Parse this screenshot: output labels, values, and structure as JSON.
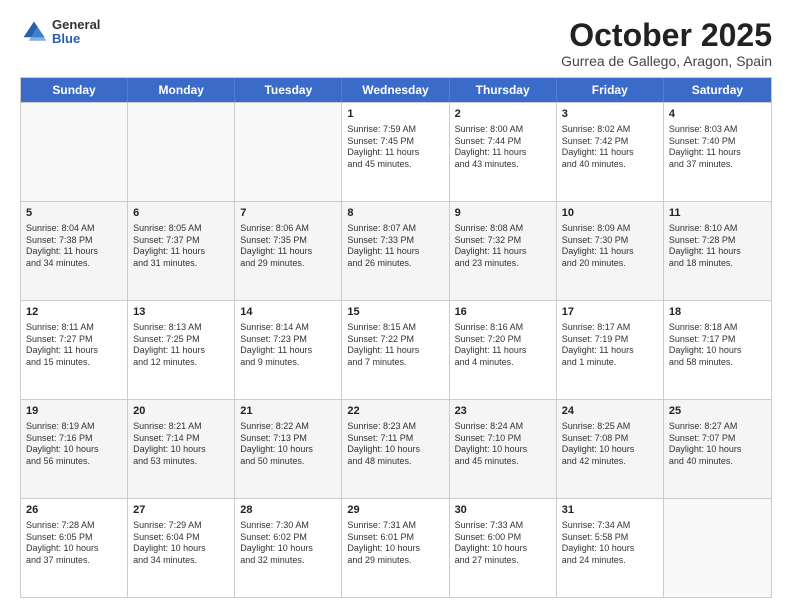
{
  "header": {
    "logo_general": "General",
    "logo_blue": "Blue",
    "month_title": "October 2025",
    "location": "Gurrea de Gallego, Aragon, Spain"
  },
  "weekdays": [
    "Sunday",
    "Monday",
    "Tuesday",
    "Wednesday",
    "Thursday",
    "Friday",
    "Saturday"
  ],
  "rows": [
    [
      {
        "day": "",
        "info": "",
        "empty": true
      },
      {
        "day": "",
        "info": "",
        "empty": true
      },
      {
        "day": "",
        "info": "",
        "empty": true
      },
      {
        "day": "1",
        "info": "Sunrise: 7:59 AM\nSunset: 7:45 PM\nDaylight: 11 hours\nand 45 minutes.",
        "empty": false
      },
      {
        "day": "2",
        "info": "Sunrise: 8:00 AM\nSunset: 7:44 PM\nDaylight: 11 hours\nand 43 minutes.",
        "empty": false
      },
      {
        "day": "3",
        "info": "Sunrise: 8:02 AM\nSunset: 7:42 PM\nDaylight: 11 hours\nand 40 minutes.",
        "empty": false
      },
      {
        "day": "4",
        "info": "Sunrise: 8:03 AM\nSunset: 7:40 PM\nDaylight: 11 hours\nand 37 minutes.",
        "empty": false
      }
    ],
    [
      {
        "day": "5",
        "info": "Sunrise: 8:04 AM\nSunset: 7:38 PM\nDaylight: 11 hours\nand 34 minutes.",
        "empty": false
      },
      {
        "day": "6",
        "info": "Sunrise: 8:05 AM\nSunset: 7:37 PM\nDaylight: 11 hours\nand 31 minutes.",
        "empty": false
      },
      {
        "day": "7",
        "info": "Sunrise: 8:06 AM\nSunset: 7:35 PM\nDaylight: 11 hours\nand 29 minutes.",
        "empty": false
      },
      {
        "day": "8",
        "info": "Sunrise: 8:07 AM\nSunset: 7:33 PM\nDaylight: 11 hours\nand 26 minutes.",
        "empty": false
      },
      {
        "day": "9",
        "info": "Sunrise: 8:08 AM\nSunset: 7:32 PM\nDaylight: 11 hours\nand 23 minutes.",
        "empty": false
      },
      {
        "day": "10",
        "info": "Sunrise: 8:09 AM\nSunset: 7:30 PM\nDaylight: 11 hours\nand 20 minutes.",
        "empty": false
      },
      {
        "day": "11",
        "info": "Sunrise: 8:10 AM\nSunset: 7:28 PM\nDaylight: 11 hours\nand 18 minutes.",
        "empty": false
      }
    ],
    [
      {
        "day": "12",
        "info": "Sunrise: 8:11 AM\nSunset: 7:27 PM\nDaylight: 11 hours\nand 15 minutes.",
        "empty": false
      },
      {
        "day": "13",
        "info": "Sunrise: 8:13 AM\nSunset: 7:25 PM\nDaylight: 11 hours\nand 12 minutes.",
        "empty": false
      },
      {
        "day": "14",
        "info": "Sunrise: 8:14 AM\nSunset: 7:23 PM\nDaylight: 11 hours\nand 9 minutes.",
        "empty": false
      },
      {
        "day": "15",
        "info": "Sunrise: 8:15 AM\nSunset: 7:22 PM\nDaylight: 11 hours\nand 7 minutes.",
        "empty": false
      },
      {
        "day": "16",
        "info": "Sunrise: 8:16 AM\nSunset: 7:20 PM\nDaylight: 11 hours\nand 4 minutes.",
        "empty": false
      },
      {
        "day": "17",
        "info": "Sunrise: 8:17 AM\nSunset: 7:19 PM\nDaylight: 11 hours\nand 1 minute.",
        "empty": false
      },
      {
        "day": "18",
        "info": "Sunrise: 8:18 AM\nSunset: 7:17 PM\nDaylight: 10 hours\nand 58 minutes.",
        "empty": false
      }
    ],
    [
      {
        "day": "19",
        "info": "Sunrise: 8:19 AM\nSunset: 7:16 PM\nDaylight: 10 hours\nand 56 minutes.",
        "empty": false
      },
      {
        "day": "20",
        "info": "Sunrise: 8:21 AM\nSunset: 7:14 PM\nDaylight: 10 hours\nand 53 minutes.",
        "empty": false
      },
      {
        "day": "21",
        "info": "Sunrise: 8:22 AM\nSunset: 7:13 PM\nDaylight: 10 hours\nand 50 minutes.",
        "empty": false
      },
      {
        "day": "22",
        "info": "Sunrise: 8:23 AM\nSunset: 7:11 PM\nDaylight: 10 hours\nand 48 minutes.",
        "empty": false
      },
      {
        "day": "23",
        "info": "Sunrise: 8:24 AM\nSunset: 7:10 PM\nDaylight: 10 hours\nand 45 minutes.",
        "empty": false
      },
      {
        "day": "24",
        "info": "Sunrise: 8:25 AM\nSunset: 7:08 PM\nDaylight: 10 hours\nand 42 minutes.",
        "empty": false
      },
      {
        "day": "25",
        "info": "Sunrise: 8:27 AM\nSunset: 7:07 PM\nDaylight: 10 hours\nand 40 minutes.",
        "empty": false
      }
    ],
    [
      {
        "day": "26",
        "info": "Sunrise: 7:28 AM\nSunset: 6:05 PM\nDaylight: 10 hours\nand 37 minutes.",
        "empty": false
      },
      {
        "day": "27",
        "info": "Sunrise: 7:29 AM\nSunset: 6:04 PM\nDaylight: 10 hours\nand 34 minutes.",
        "empty": false
      },
      {
        "day": "28",
        "info": "Sunrise: 7:30 AM\nSunset: 6:02 PM\nDaylight: 10 hours\nand 32 minutes.",
        "empty": false
      },
      {
        "day": "29",
        "info": "Sunrise: 7:31 AM\nSunset: 6:01 PM\nDaylight: 10 hours\nand 29 minutes.",
        "empty": false
      },
      {
        "day": "30",
        "info": "Sunrise: 7:33 AM\nSunset: 6:00 PM\nDaylight: 10 hours\nand 27 minutes.",
        "empty": false
      },
      {
        "day": "31",
        "info": "Sunrise: 7:34 AM\nSunset: 5:58 PM\nDaylight: 10 hours\nand 24 minutes.",
        "empty": false
      },
      {
        "day": "",
        "info": "",
        "empty": true
      }
    ]
  ]
}
